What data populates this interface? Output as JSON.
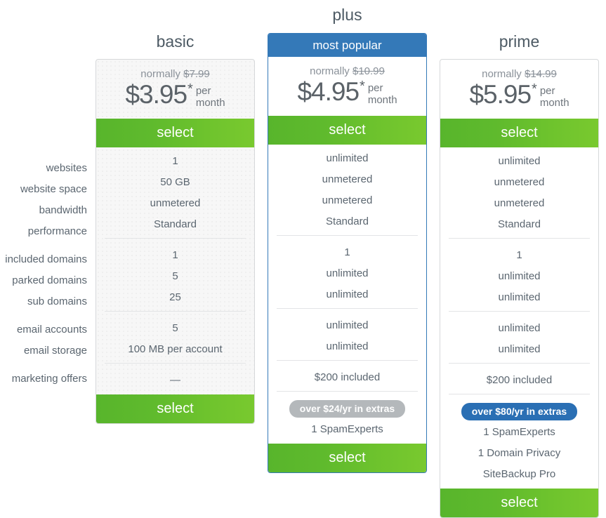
{
  "feature_labels": [
    "websites",
    "website space",
    "bandwidth",
    "performance",
    "included domains",
    "parked domains",
    "sub domains",
    "email accounts",
    "email storage",
    "marketing offers"
  ],
  "colors": {
    "green": "#5fba2d",
    "blue": "#3479b8",
    "badge_gray": "#b4b8bb",
    "badge_blue": "#2a6fb4",
    "text": "#5b6670"
  },
  "plans": [
    {
      "name": "basic",
      "ribbon": null,
      "normally_prefix": "normally",
      "normally_price": "$7.99",
      "amount": "$3.95",
      "asterisk": "*",
      "per_month": "per month",
      "select_label": "select",
      "features": [
        "1",
        "50 GB",
        "unmetered",
        "Standard",
        "1",
        "5",
        "25",
        "5",
        "100 MB per account",
        "—"
      ],
      "badge": null,
      "extras": [],
      "bottom_select_label": "select"
    },
    {
      "name": "plus",
      "ribbon": "most popular",
      "normally_prefix": "normally",
      "normally_price": "$10.99",
      "amount": "$4.95",
      "asterisk": "*",
      "per_month": "per month",
      "select_label": "select",
      "features": [
        "unlimited",
        "unmetered",
        "unmetered",
        "Standard",
        "1",
        "unlimited",
        "unlimited",
        "unlimited",
        "unlimited",
        "$200 included"
      ],
      "badge": "over $24/yr in extras",
      "extras": [
        "1 SpamExperts"
      ],
      "bottom_select_label": "select"
    },
    {
      "name": "prime",
      "ribbon": null,
      "normally_prefix": "normally",
      "normally_price": "$14.99",
      "amount": "$5.95",
      "asterisk": "*",
      "per_month": "per month",
      "select_label": "select",
      "features": [
        "unlimited",
        "unmetered",
        "unmetered",
        "Standard",
        "1",
        "unlimited",
        "unlimited",
        "unlimited",
        "unlimited",
        "$200 included"
      ],
      "badge": "over $80/yr in extras",
      "extras": [
        "1 SpamExperts",
        "1 Domain Privacy",
        "SiteBackup Pro"
      ],
      "bottom_select_label": "select"
    }
  ]
}
